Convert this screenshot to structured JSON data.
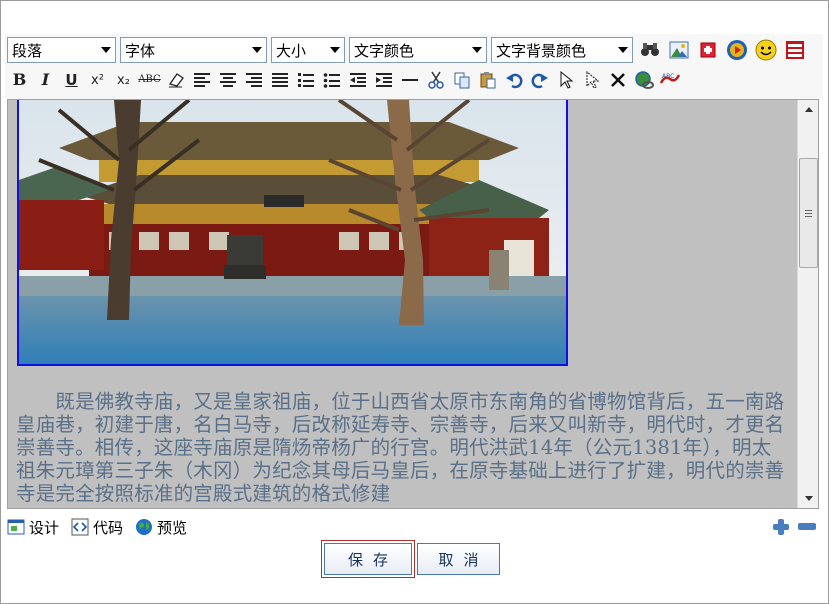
{
  "toolbar": {
    "dropdowns": [
      {
        "label": "段落"
      },
      {
        "label": "字体"
      },
      {
        "label": "大小"
      },
      {
        "label": "文字颜色"
      },
      {
        "label": "文字背景颜色"
      }
    ],
    "row1_icons": [
      "find-icon",
      "image-icon",
      "table-icon",
      "media-icon",
      "emoticon-icon",
      "special-char-icon"
    ],
    "format": {
      "bold": "B",
      "italic": "I",
      "underline": "U",
      "superscript": "x²",
      "subscript": "x₂",
      "strike": "ABC"
    }
  },
  "editor": {
    "paragraph": "　　既是佛教寺庙，又是皇家祖庙，位于山西省太原市东南角的省博物馆背后，五一南路皇庙巷，初建于唐，名白马寺，后改称延寿寺、宗善寺，后来又叫新寺，明代时，才更名崇善寺。相传，这座寺庙原是隋炀帝杨广的行宫。明代洪武14年（公元1381年），明太祖朱元璋第三子朱（木冈）为纪念其母后马皇后，在原寺基础上进行了扩建，明代的崇善寺是完全按照标准的宫殿式建筑的格式修建",
    "text_color": "#5a6f88",
    "background": "#c0c0c0"
  },
  "modes": {
    "design": "设计",
    "code": "代码",
    "preview": "预览"
  },
  "actions": {
    "save": "保存",
    "cancel": "取消"
  },
  "colors": {
    "accent": "#4a78b0",
    "photo_border": "#1010e0",
    "focus_outline": "#b03030"
  }
}
